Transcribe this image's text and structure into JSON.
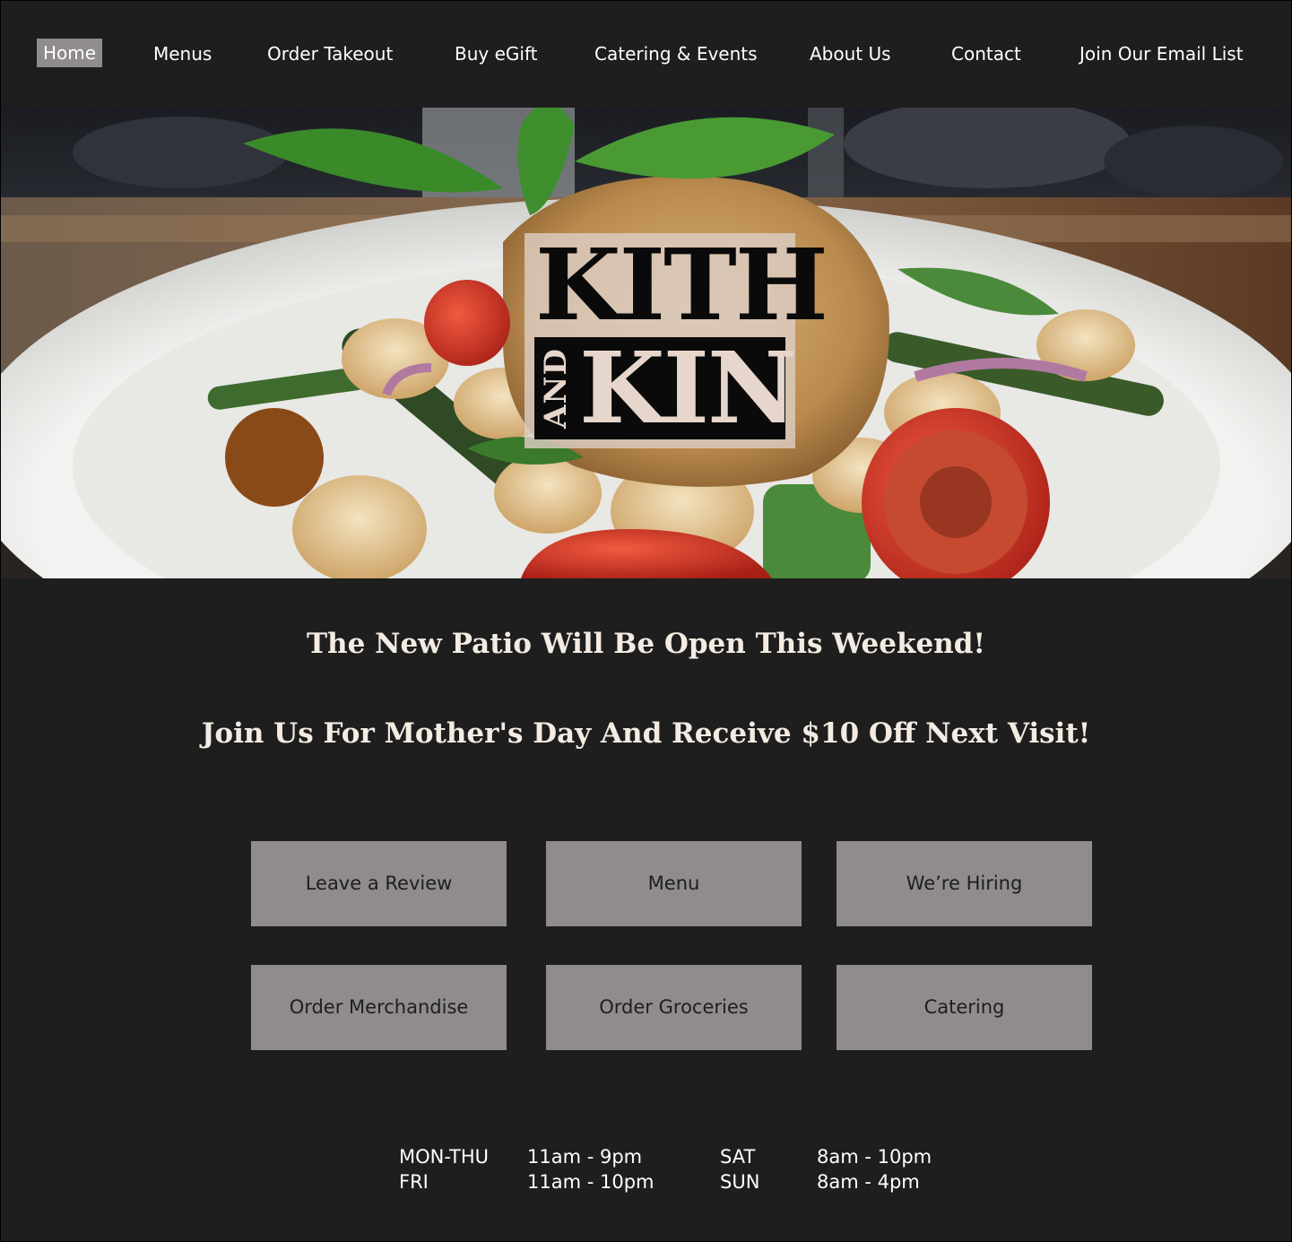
{
  "nav": {
    "items": [
      {
        "label": "Home",
        "active": true
      },
      {
        "label": "Menus"
      },
      {
        "label": "Order Takeout"
      },
      {
        "label": "Buy eGift"
      },
      {
        "label": "Catering & Events"
      },
      {
        "label": "About Us"
      },
      {
        "label": "Contact"
      },
      {
        "label": "Join Our Email List"
      }
    ]
  },
  "hero": {
    "logo_line1": "KITH",
    "logo_and": "AND",
    "logo_line2": "KIN",
    "image": "plated-dish-photo"
  },
  "announcements": [
    "The New Patio Will Be Open This Weekend!",
    "Join Us For Mother's Day And Receive $10 Off Next Visit!"
  ],
  "buttons": [
    "Leave a Review",
    "Menu",
    "We’re Hiring",
    "Order Merchandise",
    "Order Groceries",
    "Catering"
  ],
  "hours": [
    {
      "day": "MON-THU",
      "time": "11am - 9pm"
    },
    {
      "day": "FRI",
      "time": "11am - 10pm"
    },
    {
      "day": "SAT",
      "time": "8am - 10pm"
    },
    {
      "day": "SUN",
      "time": "8am - 4pm"
    }
  ],
  "colors": {
    "background": "#1e1e1e",
    "button": "#8f8c8b",
    "heading": "#f4ece2"
  }
}
